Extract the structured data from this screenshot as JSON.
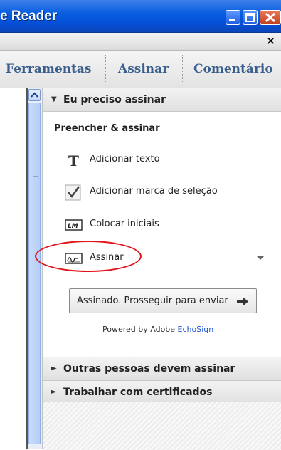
{
  "window": {
    "title": "e Reader",
    "controls": {
      "minimize": "minimize-icon",
      "maximize": "maximize-icon",
      "close": "close-icon"
    }
  },
  "menubar": {
    "close_glyph": "×"
  },
  "tabs": [
    {
      "label": "Ferramentas"
    },
    {
      "label": "Assinar"
    },
    {
      "label": "Comentário"
    }
  ],
  "panel": {
    "section_open": {
      "label": "Eu preciso assinar",
      "arrow": "▼"
    },
    "subheading": "Preencher & assinar",
    "items": [
      {
        "label": "Adicionar texto",
        "icon": "text-T-icon"
      },
      {
        "label": "Adicionar marca de seleção",
        "icon": "checkmark-icon"
      },
      {
        "label": "Colocar iniciais",
        "icon": "initials-LM-icon"
      },
      {
        "label": "Assinar",
        "icon": "signature-icon"
      }
    ],
    "send_button": {
      "label": "Assinado. Prosseguir para enviar"
    },
    "powered_by": {
      "prefix": "Powered by Adobe",
      "brand": "EchoSign"
    },
    "sections_closed": [
      {
        "label": "Outras pessoas devem assinar",
        "arrow": "►"
      },
      {
        "label": "Trabalhar com certificados",
        "arrow": "►"
      }
    ]
  },
  "colors": {
    "titlebar": "#0a5fe0",
    "tab_text": "#3a5f8c",
    "highlight_circle": "#e0141a",
    "brand_link": "#1f52d6"
  }
}
